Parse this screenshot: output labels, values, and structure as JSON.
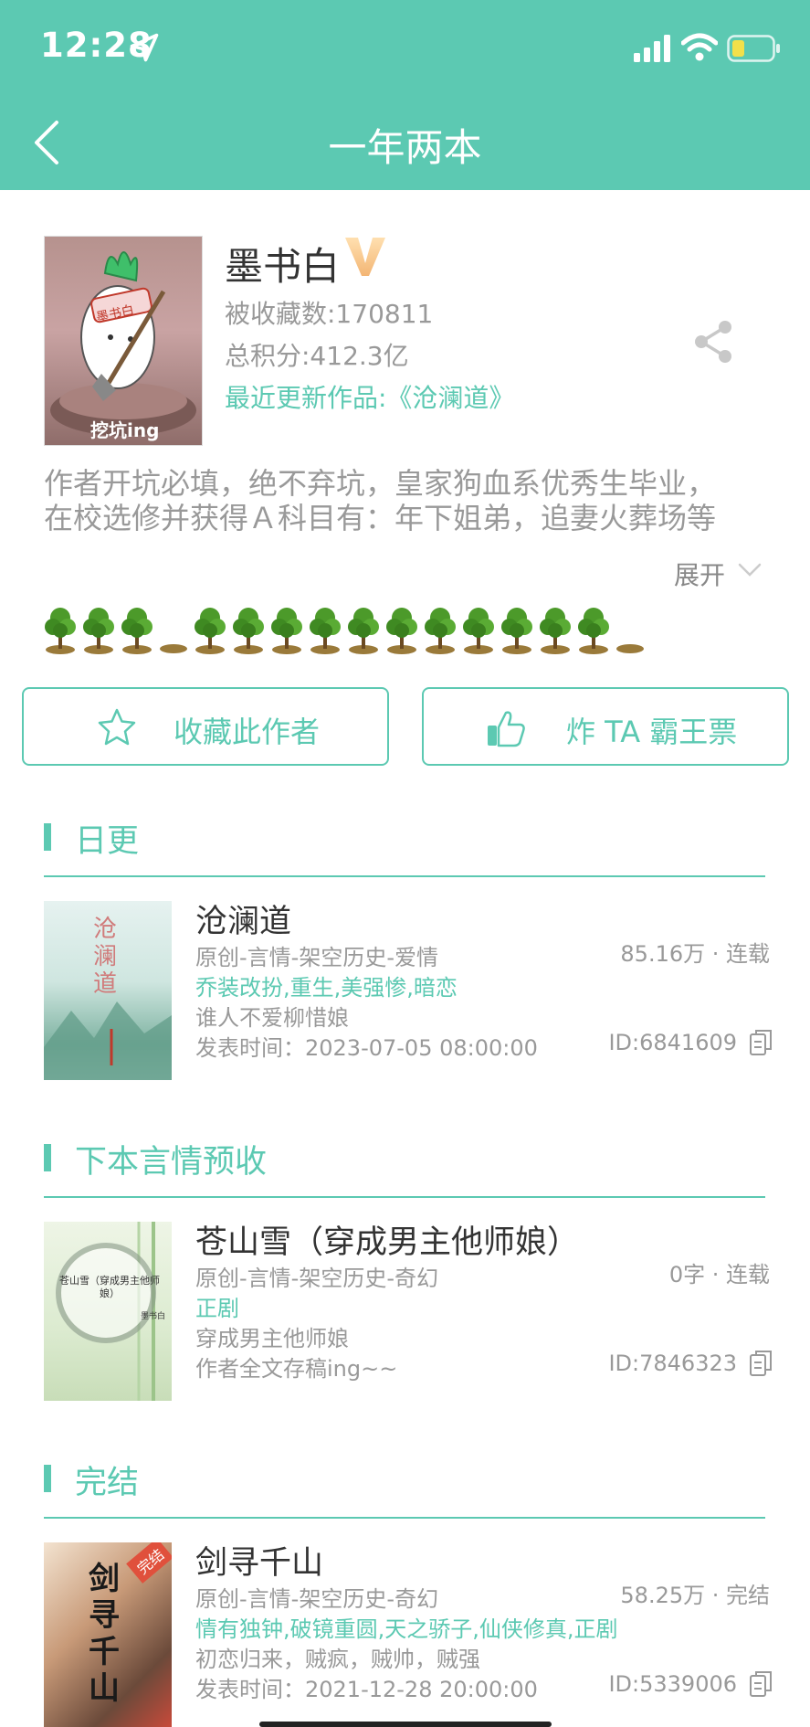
{
  "status_bar": {
    "time": "12:28"
  },
  "header": {
    "title": "一年两本"
  },
  "author": {
    "name": "墨书白",
    "favorites_label": "被收藏数:170811",
    "score_label": "总积分:412.3亿",
    "latest_label": "最近更新作品:《沧澜道》",
    "avatar_caption": "挖坑ing",
    "avatar_sign": "墨书白",
    "bio_line1": "作者开坑必填，绝不弃坑，皇家狗血系优秀生毕业，",
    "bio_line2": "在校选修并获得Ａ科目有：年下姐弟，追妻火葬场等",
    "expand_label": "展开"
  },
  "buttons": {
    "favorite": "收藏此作者",
    "vote": "炸 TA 霸王票"
  },
  "sections": [
    {
      "title": "日更",
      "book": {
        "title": "沧澜道",
        "category": "原创-言情-架空历史-爱情",
        "tags": "乔装改扮,重生,美强惨,暗恋",
        "desc": "谁人不爱柳惜娘",
        "time": "发表时间：2023-07-05 08:00:00",
        "stats": "85.16万 · 连载",
        "id": "ID:6841609",
        "cover_text": "沧澜道"
      }
    },
    {
      "title": "下本言情预收",
      "book": {
        "title": "苍山雪（穿成男主他师娘）",
        "category": "原创-言情-架空历史-奇幻",
        "tags": "正剧",
        "desc": "穿成男主他师娘",
        "time": "作者全文存稿ing~~",
        "stats": "0字 · 连载",
        "id": "ID:7846323",
        "cover_text": "苍山雪（穿成男主他师娘）",
        "cover_sign": "墨书白"
      }
    },
    {
      "title": "完结",
      "book": {
        "title": "剑寻千山",
        "category": "原创-言情-架空历史-奇幻",
        "tags": "情有独钟,破镜重圆,天之骄子,仙侠修真,正剧",
        "desc": "初恋归来，贼疯，贼帅，贼强",
        "time": "发表时间：2021-12-28 20:00:00",
        "stats": "58.25万 · 完结",
        "id": "ID:5339006",
        "cover_text": "剑寻千山",
        "cover_badge": "完结"
      }
    }
  ],
  "trees": [
    "tree",
    "tree",
    "tree",
    "mound",
    "tree",
    "tree",
    "tree",
    "tree",
    "tree",
    "tree",
    "tree",
    "tree",
    "tree",
    "tree",
    "tree",
    "mound"
  ],
  "colors": {
    "accent": "#5cc9b2",
    "text_gray": "#999999",
    "title_dark": "#333333"
  }
}
